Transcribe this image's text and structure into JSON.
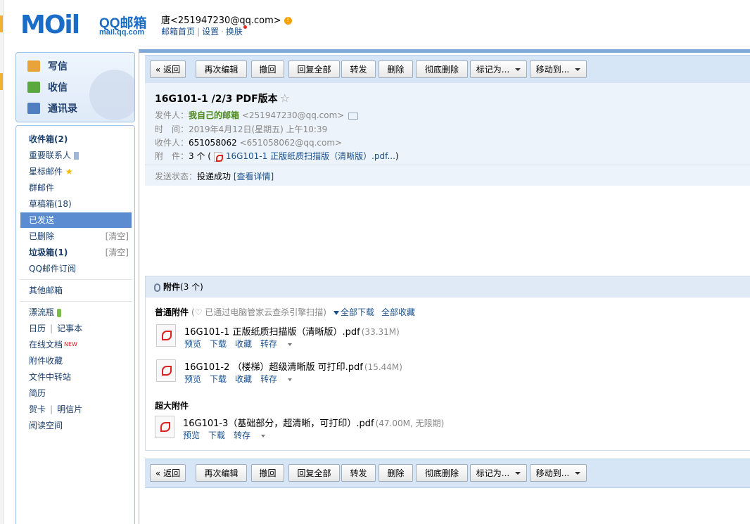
{
  "brand": {
    "logo": "MOil",
    "name": "QQ邮箱",
    "domain": "mail.qq.com"
  },
  "user": {
    "display": "唐<251947230@qq.com>",
    "badge": "!",
    "links": [
      "邮箱首页",
      "设置",
      "换肤"
    ],
    "sep_dot": "·"
  },
  "quick_actions": [
    "写信",
    "收信",
    "通讯录"
  ],
  "nav": {
    "inbox": "收件箱(2)",
    "vip": "重要联系人",
    "starred": "星标邮件",
    "group": "群邮件",
    "drafts": "草稿箱(18)",
    "sent": "已发送",
    "deleted": "已删除",
    "spam": "垃圾箱(1)",
    "clear": "[清空]",
    "subscription": "QQ邮件订阅",
    "other": "其他邮箱",
    "bottle": "漂流瓶",
    "calendar": "日历",
    "notebook": "记事本",
    "docs": "在线文档",
    "new": "NEW",
    "favorites": "附件收藏",
    "transfer": "文件中转站",
    "resume": "简历",
    "cards": "贺卡",
    "postcard": "明信片",
    "reading": "阅读空间",
    "star_glyph": "★"
  },
  "toolbar": {
    "back": "« 返回",
    "reedit": "再次编辑",
    "recall": "撤回",
    "reply_all": "回复全部",
    "forward": "转发",
    "delete": "删除",
    "delete_perm": "彻底删除",
    "mark_as": "标记为...",
    "move_to": "移动到..."
  },
  "mail": {
    "subject": "16G101-1 /2/3 PDF版本",
    "star": "☆",
    "from_label": "发件人：",
    "from_name": "我自己的邮箱",
    "from_email": "<251947230@qq.com>",
    "time_label": "时　间：",
    "time": "2019年4月12日(星期五) 上午10:39",
    "to_label": "收件人：",
    "to_name": "651058062",
    "to_email": "<651058062@qq.com>",
    "att_label": "附　件：",
    "att_count": "3 个",
    "att_open": "(",
    "att_first": "16G101-1 正版纸质扫描版（清晰版）.pdf...",
    "att_close": ")",
    "status_label": "发送状态：",
    "status_value": "投递成功",
    "status_link": "[查看详情]"
  },
  "attachments": {
    "header_title": "附件",
    "header_count": "(3 个)",
    "normal_title": "普通附件",
    "scan_note": "(♡ 已通过电脑管家云查杀引擎扫描)",
    "download_all": "全部下载",
    "collect_all": "全部收藏",
    "large_title": "超大附件",
    "files": [
      {
        "name": "16G101-1 正版纸质扫描版（清晰版）.pdf",
        "size": "(33.31M)",
        "actions": [
          "预览",
          "下载",
          "收藏",
          "转存"
        ]
      },
      {
        "name": "16G101-2 （楼梯）超级清晰版 可打印.pdf",
        "size": "(15.44M)",
        "actions": [
          "预览",
          "下载",
          "收藏",
          "转存"
        ]
      },
      {
        "name": "16G101-3（基础部分，超清晰，可打印）.pdf",
        "size": "(47.00M, 无限期)",
        "actions": [
          "预览",
          "下载",
          "转存"
        ]
      }
    ]
  }
}
